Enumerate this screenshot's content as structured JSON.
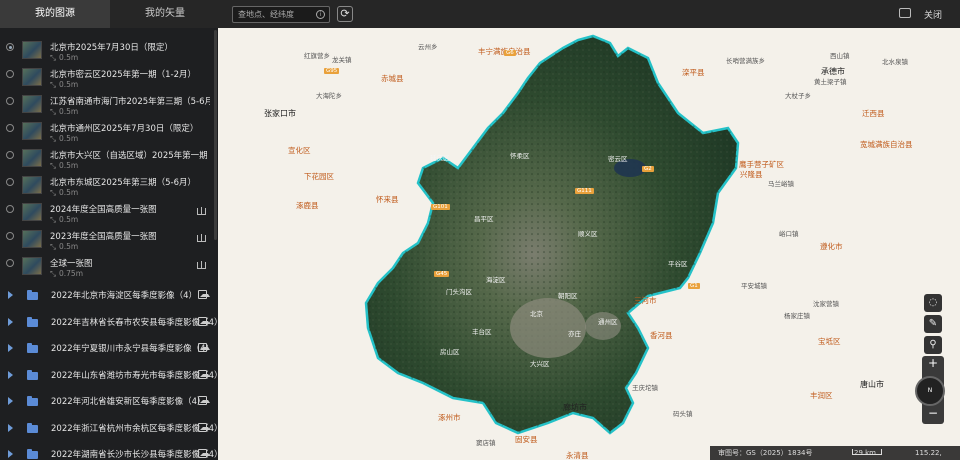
{
  "tabs": {
    "my_images": "我的图源",
    "my_vectors": "我的矢量"
  },
  "search": {
    "placeholder": "查地点、经纬度"
  },
  "topbar": {
    "close_label": "关闭"
  },
  "image_items": [
    {
      "title": "北京市2025年7月30日（限定）",
      "resolution": "0.5m"
    },
    {
      "title": "北京市密云区2025年第一期（1-2月）",
      "resolution": "0.5m"
    },
    {
      "title": "江苏省南通市海门市2025年第三期（5-6月）",
      "resolution": "0.5m"
    },
    {
      "title": "北京市通州区2025年7月30日（限定）",
      "resolution": "0.5m"
    },
    {
      "title": "北京市大兴区（自选区域）2025年第一期（1-2...",
      "resolution": "0.5m"
    },
    {
      "title": "北京市东城区2025年第三期（5-6月）",
      "resolution": "0.5m"
    },
    {
      "title": "2024年度全国高质量一张图",
      "resolution": "0.5m"
    },
    {
      "title": "2023年度全国高质量一张图",
      "resolution": "0.5m"
    },
    {
      "title": "全球一张图",
      "resolution": "0.75m"
    }
  ],
  "folder_items": [
    {
      "title": "2022年北京市海淀区每季度影像（4）"
    },
    {
      "title": "2022年吉林省长春市农安县每季度影像（4）"
    },
    {
      "title": "2022年宁夏银川市永宁县每季度影像（4）"
    },
    {
      "title": "2022年山东省潍坊市寿光市每季度影像（4）"
    },
    {
      "title": "2022年河北省雄安新区每季度影像（4）"
    },
    {
      "title": "2022年浙江省杭州市余杭区每季度影像（4）"
    },
    {
      "title": "2022年湖南省长沙市长沙县每季度影像（4）"
    }
  ],
  "map_labels": {
    "zhangjiakou": "张家口市",
    "chengde": "承德市",
    "tangshan": "唐山市",
    "langfang": "廊坊市",
    "beijing": "北京",
    "tongzhou": "通州区",
    "chicheng": "赤城县",
    "fengning": "丰宁满族自治县",
    "luanping": "滦平县",
    "xinglong": "兴隆县",
    "zunhua": "遵化市",
    "sanhe": "三河市",
    "xiahuayuan": "下花园区",
    "huailai": "怀来县",
    "zhuolu": "涿鹿县",
    "zhuozhou": "涿州市",
    "gu_an": "固安县",
    "xianghe": "香河县",
    "baodi": "宝坻区",
    "yongqing": "永清县",
    "yingshou": "鹰手营子矿区",
    "xuanhua": "宣化区",
    "kuancheng": "宽城满族自治县",
    "qianxi": "迁西县",
    "fengrun": "丰润区",
    "huairou": "怀柔区",
    "miyun": "密云区",
    "pinggu": "平谷区",
    "yanqing": "延庆区",
    "changping": "昌平区",
    "shunyi": "顺义区",
    "mentougou": "门头沟区",
    "fangshan": "房山区",
    "daxing": "大兴区",
    "haidian": "海淀区",
    "chaoyang": "朝阳区",
    "fengtai": "丰台区",
    "yizhuang": "亦庄",
    "village1": "红旗营乡",
    "village2": "云州乡",
    "village3": "龙关镇",
    "village4": "大海陀乡",
    "village5": "西山镇",
    "village6": "长哨营满族乡",
    "village7": "黄土梁子镇",
    "village8": "北水泉镇",
    "village9": "大杖子乡",
    "village10": "马兰峪镇",
    "village11": "峪口镇",
    "village12": "平安城镇",
    "village13": "沈家营镇",
    "village14": "王庆坨镇",
    "village15": "窦店镇",
    "village16": "码头镇",
    "village17": "杨家庄镇"
  },
  "map_codes": [
    "G95",
    "G6",
    "G45",
    "G111",
    "G101",
    "G2",
    "G1"
  ],
  "bottom": {
    "approval": "审图号：GS（2025）1834号",
    "scale": "29 km",
    "coords": "115.22, 40.45"
  },
  "colors": {
    "boundary": "#24c2c8",
    "folder": "#5b8bd6",
    "city_label": "#c05a1a"
  }
}
